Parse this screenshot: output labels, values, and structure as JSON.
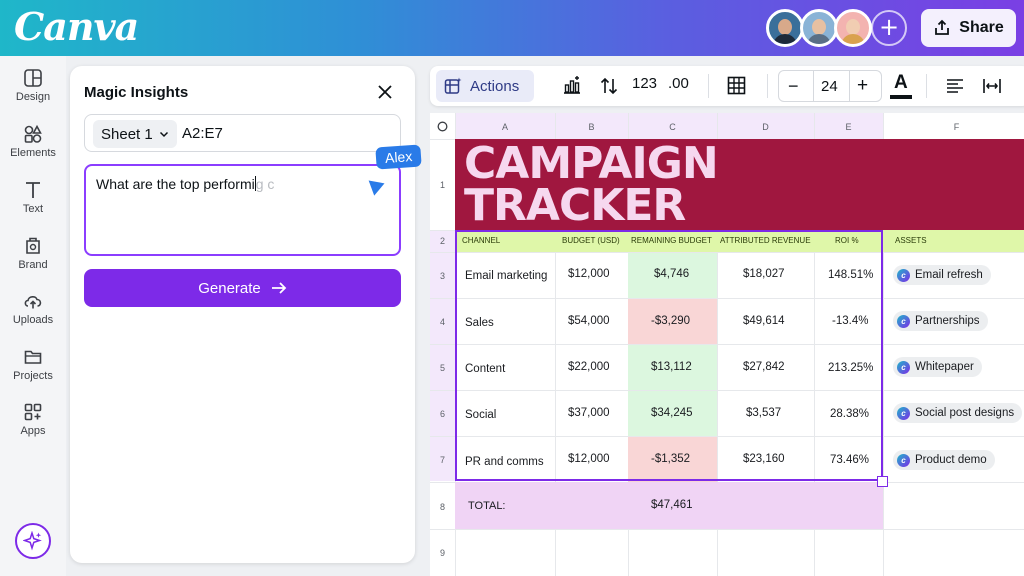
{
  "topbar": {
    "logo": "Canva",
    "add_label": "+",
    "share_label": "Share"
  },
  "rail": {
    "items": [
      {
        "label": "Design",
        "icon": "layout-icon"
      },
      {
        "label": "Elements",
        "icon": "shapes-icon"
      },
      {
        "label": "Text",
        "icon": "text-icon"
      },
      {
        "label": "Brand",
        "icon": "brand-icon"
      },
      {
        "label": "Uploads",
        "icon": "upload-cloud-icon"
      },
      {
        "label": "Projects",
        "icon": "folder-icon"
      },
      {
        "label": "Apps",
        "icon": "apps-grid-icon"
      }
    ]
  },
  "panel": {
    "title": "Magic Insights",
    "sheet_label": "Sheet 1",
    "range_value": "A2:E7",
    "prompt_typed": "What are the top performi",
    "prompt_ghost": "g c",
    "collaborator": "Alex",
    "generate_label": "Generate"
  },
  "toolbar": {
    "actions_label": "Actions",
    "number_format": "123",
    "decimal_format": ".00",
    "font_size": "24",
    "minus": "−",
    "plus": "+",
    "text_color": "A"
  },
  "sheet": {
    "columns": [
      "A",
      "B",
      "C",
      "D",
      "E",
      "F"
    ],
    "rows": [
      "1",
      "2",
      "3",
      "4",
      "5",
      "6",
      "7",
      "8",
      "9"
    ],
    "title_line1": "CAMPAIGN",
    "title_line2": "TRACKER",
    "headers": [
      "CHANNEL",
      "BUDGET (USD)",
      "REMAINING BUDGET",
      "ATTRIBUTED REVENUE",
      "ROI %",
      "ASSETS"
    ],
    "data": [
      {
        "channel": "Email marketing",
        "budget": "$12,000",
        "remaining": "$4,746",
        "revenue": "$18,027",
        "roi": "148.51%",
        "asset": "Email refresh"
      },
      {
        "channel": "Sales",
        "budget": "$54,000",
        "remaining": "-$3,290",
        "revenue": "$49,614",
        "roi": "-13.4%",
        "asset": "Partnerships"
      },
      {
        "channel": "Content",
        "budget": "$22,000",
        "remaining": "$13,112",
        "revenue": "$27,842",
        "roi": "213.25%",
        "asset": "Whitepaper"
      },
      {
        "channel": "Social",
        "budget": "$37,000",
        "remaining": "$34,245",
        "revenue": "$3,537",
        "roi": "28.38%",
        "asset": "Social post designs"
      },
      {
        "channel": "PR and comms",
        "budget": "$12,000",
        "remaining": "-$1,352",
        "revenue": "$23,160",
        "roi": "73.46%",
        "asset": "Product demo"
      }
    ],
    "total_label": "TOTAL:",
    "total_value": "$47,461"
  },
  "colors": {
    "accent": "#7d2ae8",
    "title_band": "#a0173f",
    "header_band": "#dff7a9",
    "positive": "#dcf7df",
    "negative": "#f9d6d6",
    "total_band": "#f0d4f5",
    "collaborator": "#2a7be8"
  }
}
